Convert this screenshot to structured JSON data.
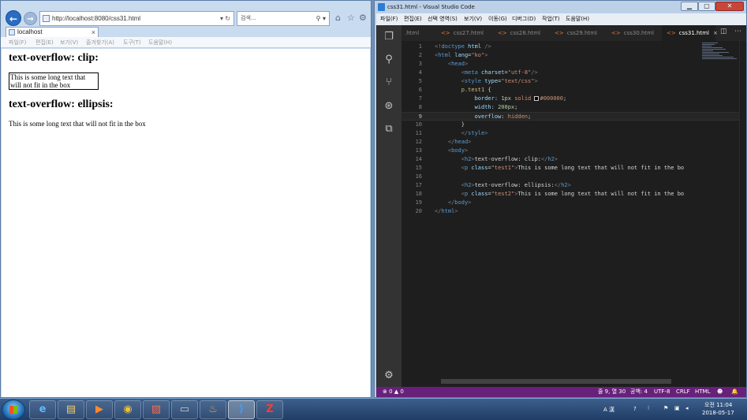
{
  "ie": {
    "address_url": "http://localhost:8080/css31.html",
    "address_controls": "▾ ↻",
    "search_placeholder": "검색...",
    "search_controls": "⚲ ▾",
    "tab_title": "localhost",
    "tab_close": "×",
    "menu": [
      "파일(F)",
      "편집(E)",
      "보기(V)",
      "즐겨찾기(A)",
      "도구(T)",
      "도움말(H)"
    ],
    "content": {
      "heading1": "text-overflow: clip:",
      "paragraph1": "This is some long text that will not fit in the box",
      "heading2": "text-overflow: ellipsis:",
      "paragraph2": "This is some long text that will not fit in the box"
    }
  },
  "vscode": {
    "window_title": "css31.html - Visual Studio Code",
    "window_controls": {
      "minimize": "▁",
      "maximize": "▢",
      "close": "✕"
    },
    "menu": [
      "파일(F)",
      "편집(E)",
      "선택 영역(S)",
      "보기(V)",
      "이동(G)",
      "디버그(D)",
      "작업(T)",
      "도움말(H)"
    ],
    "tabs": [
      {
        "label": ".html",
        "active": false
      },
      {
        "label": "css27.html",
        "active": false
      },
      {
        "label": "css28.html",
        "active": false
      },
      {
        "label": "css29.html",
        "active": false
      },
      {
        "label": "css30.html",
        "active": false
      },
      {
        "label": "css31.html",
        "active": true
      }
    ],
    "tab_close": "×",
    "code_lines": [
      "<!doctype html />",
      "<html lang=\"ko\">",
      "    <head>",
      "        <meta charset=\"utf-8\"/>",
      "        <style type=\"text/css\">",
      "        p.test1 {",
      "            border: 1px solid #000000;",
      "            width: 200px;",
      "            overflow: hidden;",
      "        }",
      "        </style>",
      "    </head>",
      "    <body>",
      "        <h2>text-overflow: clip:</h2>",
      "        <p class=\"test1\">This is some long text that will not fit in the bo",
      "",
      "        <h2>text-overflow: ellipsis:</h2>",
      "        <p class=\"test2\">This is some long text that will not fit in the bo",
      "    </body>",
      "</html>"
    ],
    "status": {
      "problems": "⊗ 0 ▲ 0",
      "position": "줄 9, 열 30",
      "spaces": "공백: 4",
      "encoding": "UTF-8",
      "eol": "CRLF",
      "language": "HTML",
      "feedback": "☻",
      "bell": "🔔"
    }
  },
  "taskbar": {
    "apps": [
      {
        "name": "internet-explorer",
        "glyph": "e"
      },
      {
        "name": "file-explorer",
        "glyph": "▤"
      },
      {
        "name": "media-player",
        "glyph": "▶"
      },
      {
        "name": "chrome",
        "glyph": "◉"
      },
      {
        "name": "paint-app",
        "glyph": "▨"
      },
      {
        "name": "command-prompt",
        "glyph": "▭"
      },
      {
        "name": "java",
        "glyph": "♨"
      },
      {
        "name": "visual-studio-code",
        "glyph": "⟩"
      },
      {
        "name": "filezilla",
        "glyph": "Z"
      }
    ],
    "tray": {
      "ime": "A 漢",
      "help": "?",
      "time": "오전 11:04",
      "date": "2018-05-17"
    }
  }
}
